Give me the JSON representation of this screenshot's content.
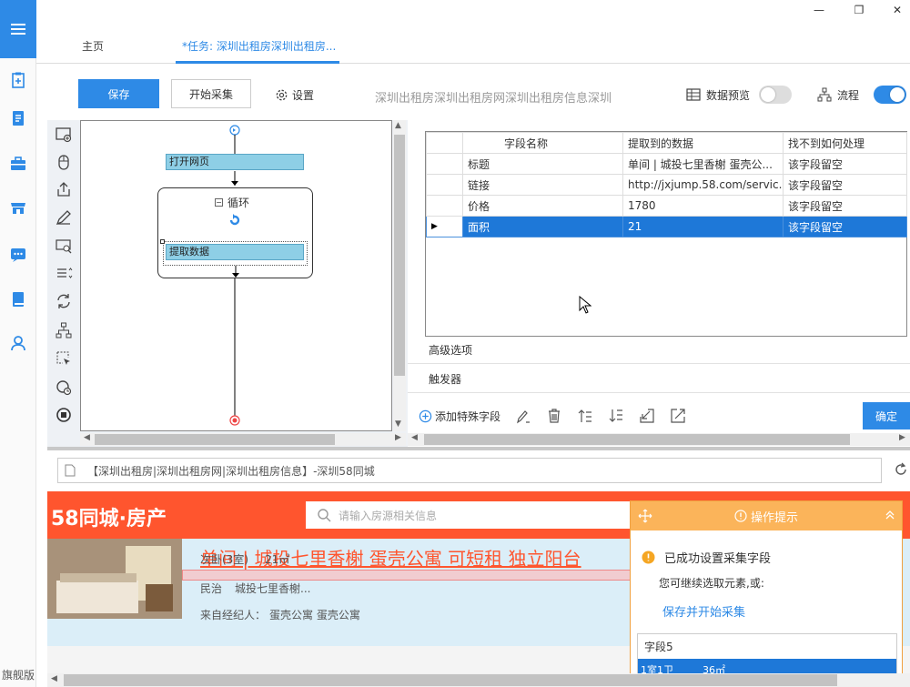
{
  "window": {
    "minimize": "—",
    "restore": "❐",
    "close": "✕"
  },
  "tabs": [
    {
      "label": "主页"
    },
    {
      "label": "*任务: 深圳出租房深圳出租房..."
    }
  ],
  "toolbar": {
    "save_label": "保存",
    "start_label": "开始采集",
    "settings_label": "设置",
    "task_title": "深圳出租房深圳出租房网深圳出租房信息深圳",
    "preview_label": "数据预览",
    "preview_on": false,
    "flow_label": "流程",
    "flow_on": true
  },
  "colors": {
    "accent": "#2e8ae6",
    "site_orange": "#ff552e",
    "selected_row": "#1e78d8",
    "tip_orange": "#fbb45a"
  },
  "sidebar": {
    "bottom_label": "旗舰版",
    "icons": [
      "task-add-icon",
      "document-icon",
      "briefcase-icon",
      "store-icon",
      "chat-icon",
      "book-icon",
      "user-icon"
    ]
  },
  "flow": {
    "open_page": "打开网页",
    "loop": "循环",
    "extract": "提取数据"
  },
  "fields_table": {
    "columns": [
      "字段名称",
      "提取到的数据",
      "找不到如何处理"
    ],
    "rows": [
      {
        "name": "标题",
        "value": "单间 | 城投七里香榭 蛋壳公...",
        "fallback": "该字段留空"
      },
      {
        "name": "链接",
        "value": "http://jxjump.58.com/servic...",
        "fallback": "该字段留空"
      },
      {
        "name": "价格",
        "value": "1780",
        "fallback": "该字段留空"
      },
      {
        "name": "面积",
        "value": "21",
        "fallback": "该字段留空"
      }
    ],
    "selected": 3
  },
  "options": {
    "advanced": "高级选项",
    "trigger": "触发器"
  },
  "bottom_tools": {
    "add_special": "添加特殊字段",
    "ok_label": "确定"
  },
  "browser": {
    "address": "【深圳出租房|深圳出租房网|深圳出租房信息】-深圳58同城",
    "brand": "58同城·房产",
    "search_placeholder": "请输入房源相关信息",
    "listing_title": "单间 | 城投七里香榭 蛋壳公寓 可短租 独立阳台",
    "room": "次卧(3室)",
    "area": "21㎡",
    "district": "民治",
    "community": "城投七里香榭...",
    "agent_label": "来自经纪人：",
    "agent": "蛋壳公寓 蛋壳公寓"
  },
  "tip": {
    "header": "操作提示",
    "success": "已成功设置采集字段",
    "hint": "您可继续选取元素,或:",
    "action": "保存并开始采集",
    "field_name": "字段5",
    "row_room": "1室1卫",
    "row_area": "36㎡"
  }
}
